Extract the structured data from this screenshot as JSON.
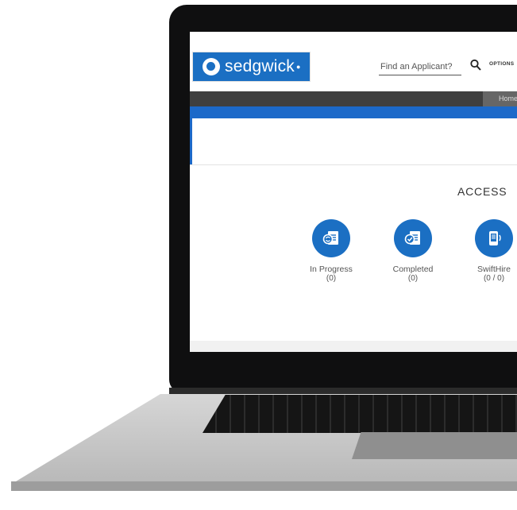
{
  "brand": {
    "name": "sedgwick",
    "accent": "#1b6fc3"
  },
  "search": {
    "placeholder": "Find an Applicant?",
    "value": "",
    "icon": "search-icon"
  },
  "header": {
    "options_label": "OPTIONS"
  },
  "nav": {
    "home_label": "Home"
  },
  "section": {
    "title": "ACCESS"
  },
  "tiles": [
    {
      "label": "In Progress",
      "count": "(0)",
      "icon": "document-refresh-icon"
    },
    {
      "label": "Completed",
      "count": "(0)",
      "icon": "document-check-icon"
    },
    {
      "label": "SwiftHire",
      "count": "(0 / 0)",
      "icon": "mobile-phone-icon"
    }
  ]
}
